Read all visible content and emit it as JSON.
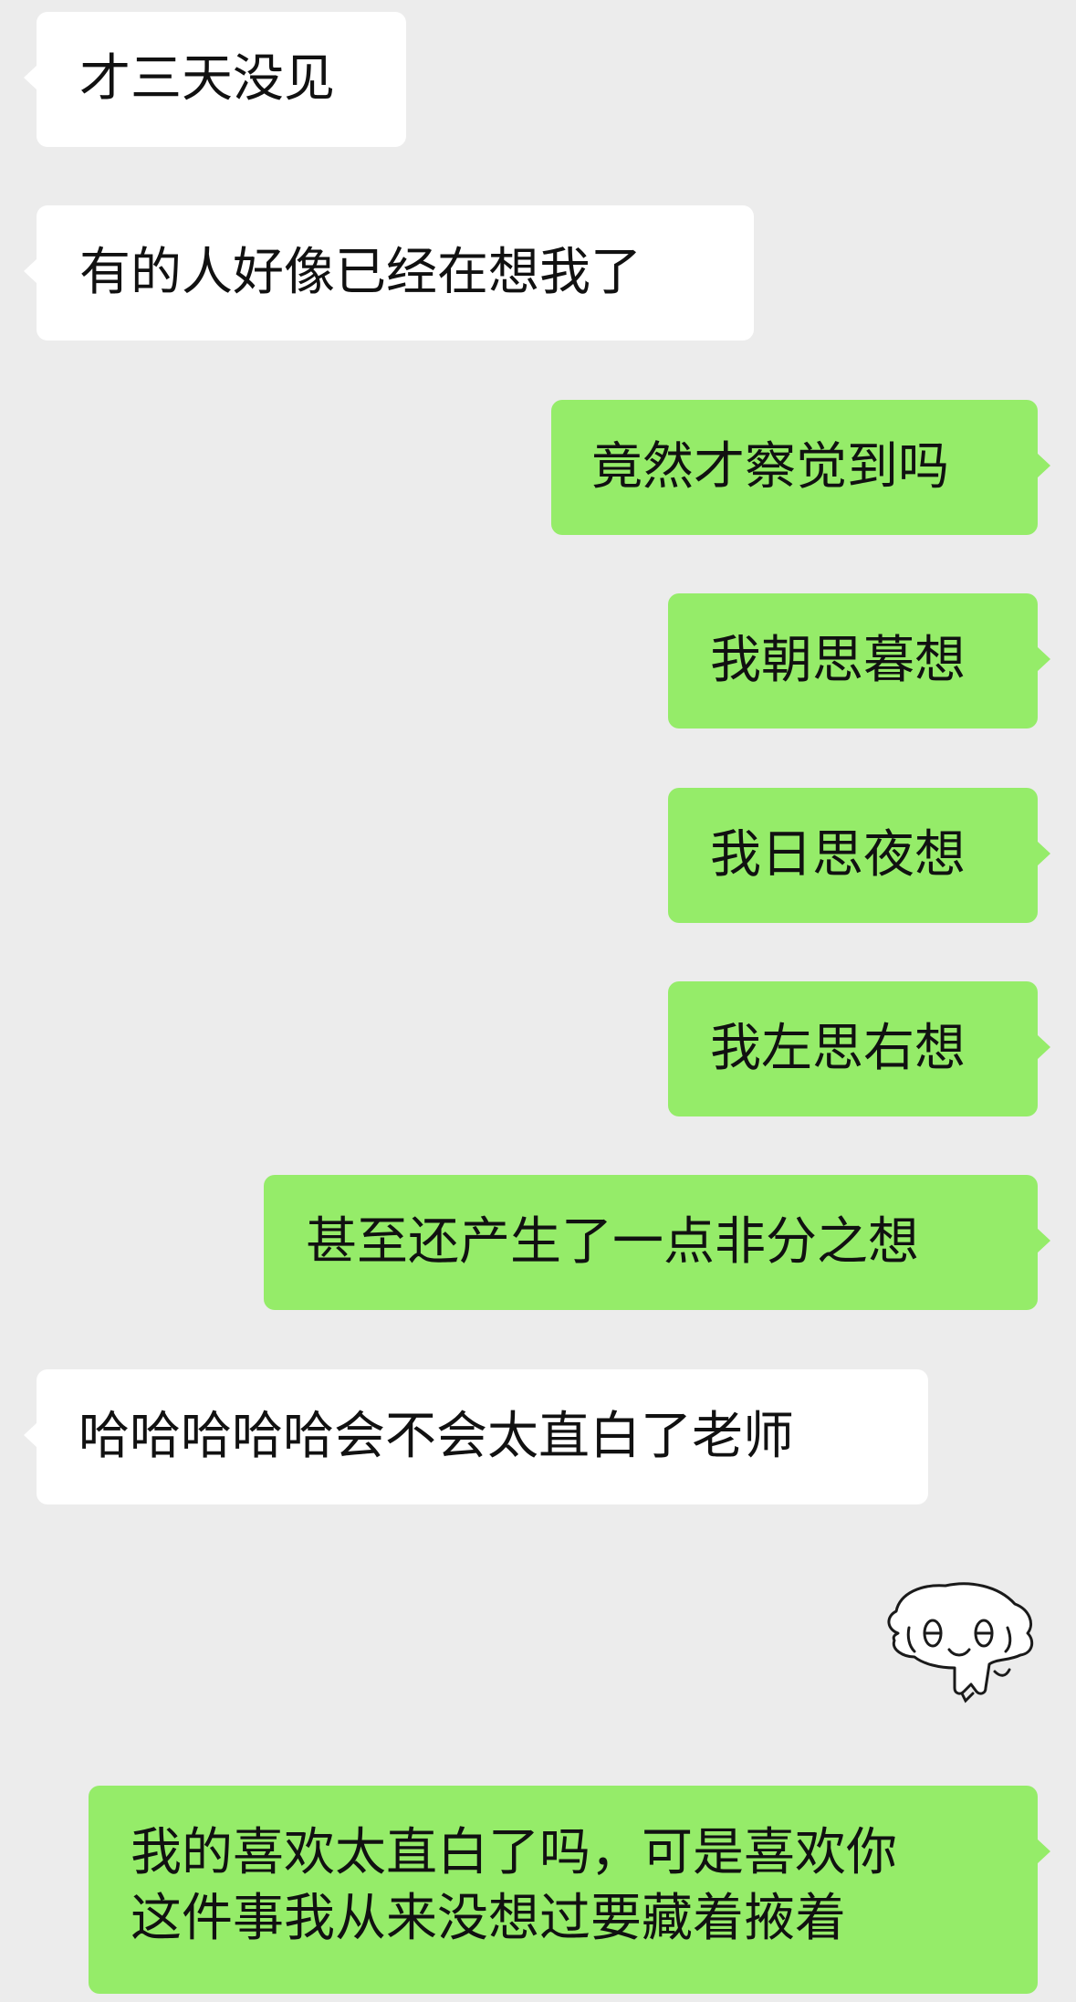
{
  "messages": [
    {
      "side": "in",
      "text": "才三天没见"
    },
    {
      "side": "in",
      "text": "有的人好像已经在想我了"
    },
    {
      "side": "out",
      "text": "竟然才察觉到吗"
    },
    {
      "side": "out",
      "text": "我朝思暮想"
    },
    {
      "side": "out",
      "text": "我日思夜想"
    },
    {
      "side": "out",
      "text": "我左思右想"
    },
    {
      "side": "out",
      "text": "甚至还产生了一点非分之想"
    },
    {
      "side": "in",
      "text": "哈哈哈哈哈会不会太直白了老师"
    },
    {
      "side": "out",
      "lines": [
        "我的喜欢太直白了吗，可是喜欢你",
        "这件事我从来没想过要藏着掖着"
      ]
    }
  ],
  "sticker": {
    "icon": "cute-blob-face-sticker"
  },
  "colors": {
    "background": "#ececec",
    "incoming_bubble": "#ffffff",
    "outgoing_bubble": "#95ec69",
    "text": "#111111"
  }
}
